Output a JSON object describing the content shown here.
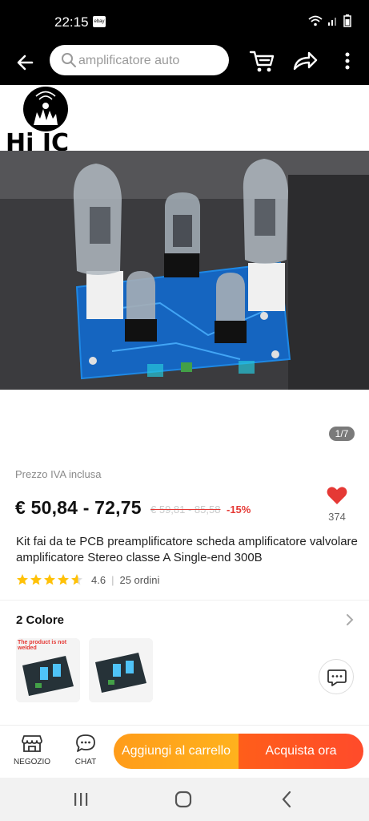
{
  "status_bar": {
    "time": "22:15",
    "notification_badge": "ebay",
    "icons": [
      "wifi-icon",
      "signal-icon",
      "battery-icon"
    ]
  },
  "top_bar": {
    "search_placeholder": "amplificatore auto",
    "icons": [
      "back-arrow-icon",
      "search-icon",
      "cart-icon",
      "share-icon",
      "more-vertical-icon"
    ]
  },
  "gallery": {
    "logo_text": "Hi IC",
    "pager": "1/7"
  },
  "product": {
    "vat_note": "Prezzo IVA inclusa",
    "price": "€ 50,84 - 72,75",
    "old_price": "€ 59,81 - 85,58",
    "discount": "-15%",
    "wishlist_count": "374",
    "title": "Kit fai da te PCB preamplificatore scheda amplificatore valvolare amplificatore Stereo classe A Single-end 300B",
    "rating_value": "4.6",
    "stars": 4.6,
    "orders": "25 ordini"
  },
  "variants": {
    "label": "2 Colore",
    "thumbs": [
      {
        "tag": "The product is not welded"
      },
      {
        "tag": ""
      }
    ]
  },
  "bottom_bar": {
    "store_label": "NEGOZIO",
    "chat_label": "CHAT",
    "add_to_cart": "Aggiungi al carrello",
    "buy_now": "Acquista ora"
  },
  "colors": {
    "accent_orange": "#ffb21d",
    "accent_red": "#ff4b2b",
    "heart": "#e53935",
    "star": "#ffc107"
  }
}
